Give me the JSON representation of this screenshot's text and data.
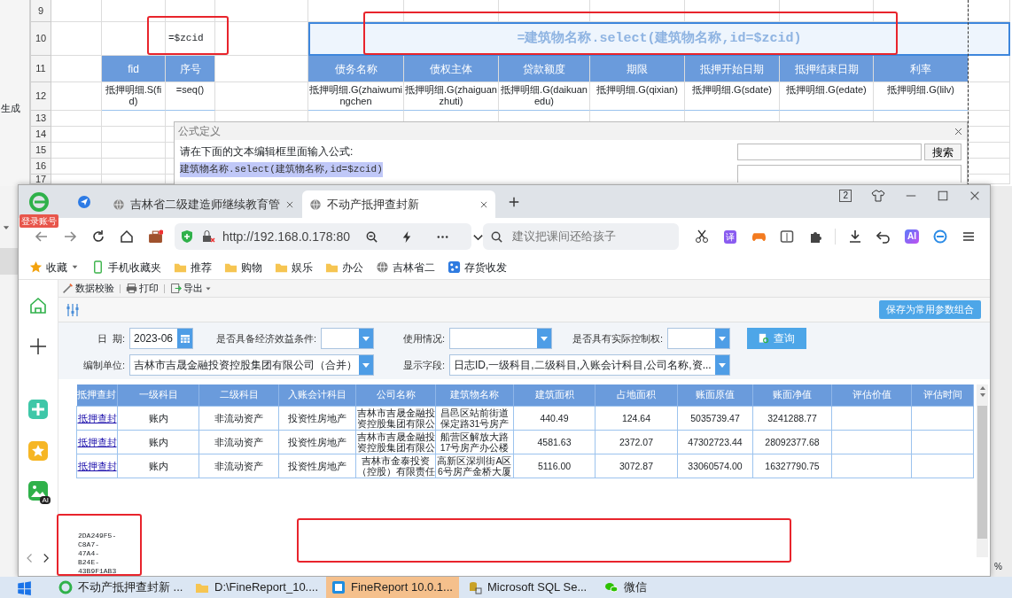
{
  "designer": {
    "side_label": "生成",
    "row_numbers": [
      "9",
      "10",
      "11",
      "12",
      "13",
      "14",
      "15",
      "16",
      "17"
    ],
    "param_cell": "=$zcid",
    "title_formula": "=建筑物名称.select(建筑物名称,id=$zcid)",
    "fields": [
      {
        "header": "fid",
        "binding": "抵押明细.S(fid)"
      },
      {
        "header": "序号",
        "binding": "=seq()"
      },
      {
        "header": "债务名称",
        "binding": "抵押明细.G(zhaiwumingchen"
      },
      {
        "header": "债权主体",
        "binding": "抵押明细.G(zhaiguanzhuti)"
      },
      {
        "header": "贷款额度",
        "binding": "抵押明细.G(daikuanedu)"
      },
      {
        "header": "期限",
        "binding": "抵押明细.G(qixian)"
      },
      {
        "header": "抵押开始日期",
        "binding": "抵押明细.G(sdate)"
      },
      {
        "header": "抵押结束日期",
        "binding": "抵押明细.G(edate)"
      },
      {
        "header": "利率",
        "binding": "抵押明细.G(lilv)"
      }
    ]
  },
  "formula_dialog": {
    "title": "公式定义",
    "prompt": "请在下面的文本编辑框里面输入公式:",
    "formula": "建筑物名称.select(建筑物名称,id=$zcid)",
    "search_button": "搜索"
  },
  "browser": {
    "badge": "登录账号",
    "tabs": [
      {
        "title": "吉林省二级建造师继续教育管",
        "selected": false
      },
      {
        "title": "不动产抵押查封新",
        "selected": true
      }
    ],
    "tab_count": "2",
    "url": "http://192.168.0.178:80",
    "search_placeholder": "建议把课间还给孩子",
    "translate_label": "译",
    "ai_label": "AI",
    "bookmarks": [
      {
        "label": "收藏",
        "kind": "star"
      },
      {
        "label": "手机收藏夹",
        "kind": "phone"
      },
      {
        "label": "推荐",
        "kind": "folder"
      },
      {
        "label": "购物",
        "kind": "folder"
      },
      {
        "label": "娱乐",
        "kind": "folder"
      },
      {
        "label": "办公",
        "kind": "folder"
      },
      {
        "label": "吉林省二",
        "kind": "globe"
      },
      {
        "label": "存货收发",
        "kind": "app"
      }
    ]
  },
  "report": {
    "sidebar_ai_label": "AI",
    "toolbar": [
      {
        "label": "数据校验",
        "kind": "check"
      },
      {
        "label": "打印",
        "kind": "print"
      },
      {
        "label": "导出",
        "kind": "export"
      }
    ],
    "save_button": "保存为常用参数组合",
    "param_rows": [
      [
        {
          "label": "日  期:",
          "value": "2023-06",
          "kind": "date"
        },
        {
          "label": "是否具备经济效益条件:",
          "kind": "select"
        },
        {
          "label": "使用情况:",
          "kind": "select"
        },
        {
          "label": "是否具有实际控制权:",
          "kind": "select"
        }
      ],
      [
        {
          "label": "编制单位:",
          "value": "吉林市吉晟金融投资控股集团有限公司（合并）",
          "kind": "select"
        },
        {
          "label": "显示字段:",
          "value": "日志ID,一级科目,二级科目,入账会计科目,公司名称,资...",
          "kind": "select"
        }
      ]
    ],
    "query_button": "查询",
    "table": {
      "columns": [
        "抵押查封",
        "一级科目",
        "二级科目",
        "入账会计科目",
        "公司名称",
        "建筑物名称",
        "建筑面积",
        "占地面积",
        "账面原值",
        "账面净值",
        "评估价值",
        "评估时间"
      ],
      "rows": [
        [
          "抵押查封",
          "账内",
          "非流动资产",
          "投资性房地产",
          "吉林市吉晟金融投资控股集团有限公",
          "昌邑区站前街道保定路31号房产",
          "440.49",
          "124.64",
          "5035739.47",
          "3241288.77"
        ],
        [
          "抵押查封",
          "账内",
          "非流动资产",
          "投资性房地产",
          "吉林市吉晟金融投资控股集团有限公",
          "船营区解放大路17号房产办公楼",
          "4581.63",
          "2372.07",
          "47302723.44",
          "28092377.68"
        ],
        [
          "抵押查封",
          "账内",
          "非流动资产",
          "投资性房地产",
          "吉林市金泰投资（控股）有限责任",
          "高新区深圳街A区6号房产金桥大厦",
          "5116.00",
          "3072.87",
          "33060574.00",
          "16327790.75"
        ]
      ]
    },
    "record_id_lines": [
      "2DA249F5-",
      "C8A7-",
      "47A4-",
      "B24E-",
      "43B9F1AB3"
    ]
  },
  "taskbar": [
    {
      "label": "不动产抵押查封新 ...",
      "kind": "browser",
      "selected": false
    },
    {
      "label": "D:\\FineReport_10....",
      "kind": "folder",
      "selected": false
    },
    {
      "label": "FineReport 10.0.1...",
      "kind": "app",
      "selected": true
    },
    {
      "label": "Microsoft SQL Se...",
      "kind": "db",
      "selected": false
    },
    {
      "label": "微信",
      "kind": "chat",
      "selected": false
    }
  ],
  "status_label": "%"
}
